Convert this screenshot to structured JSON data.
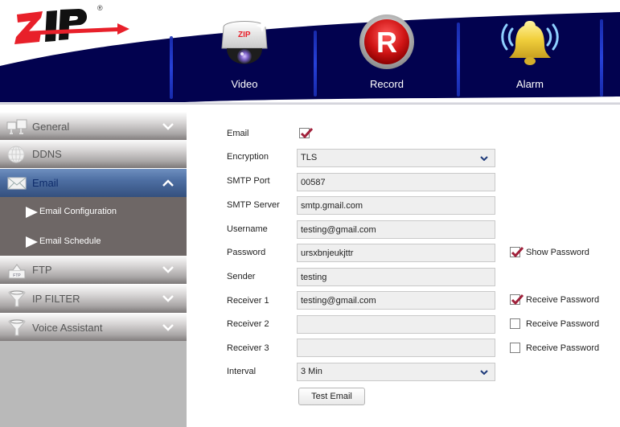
{
  "header": {
    "logo": "ZIP",
    "logo_mark": "®",
    "nav": [
      {
        "label": "Video",
        "icon": "dome-camera-icon"
      },
      {
        "label": "Record",
        "icon": "record-icon"
      },
      {
        "label": "Alarm",
        "icon": "alarm-bell-icon"
      }
    ],
    "colors": {
      "band": "#02024f",
      "logo_red": "#e8202a",
      "active_menu": "#4e6fa3",
      "check": "#a0203a"
    }
  },
  "sidebar": {
    "items": [
      {
        "label": "General",
        "icon": "network-icon",
        "expanded": false
      },
      {
        "label": "DDNS",
        "icon": "globe-icon",
        "expanded": false
      },
      {
        "label": "Email",
        "icon": "envelope-icon",
        "expanded": true
      },
      {
        "label": "FTP",
        "icon": "ftp-folder-icon",
        "expanded": false
      },
      {
        "label": "IP FILTER",
        "icon": "filter-icon",
        "expanded": false
      },
      {
        "label": "Voice Assistant",
        "icon": "filter-icon",
        "expanded": false
      }
    ],
    "email_submenu": [
      {
        "label": "Email Configuration"
      },
      {
        "label": "Email Schedule"
      }
    ]
  },
  "form": {
    "email": {
      "label": "Email",
      "checked": true
    },
    "encryption": {
      "label": "Encryption",
      "value": "TLS"
    },
    "smtp_port": {
      "label": "SMTP Port",
      "value": "00587"
    },
    "smtp_server": {
      "label": "SMTP Server",
      "value": "smtp.gmail.com"
    },
    "username": {
      "label": "Username",
      "value": "testing@gmail.com"
    },
    "password": {
      "label": "Password",
      "value": "ursxbnjeukjttr"
    },
    "show_password": {
      "label": "Show Password",
      "checked": true
    },
    "sender": {
      "label": "Sender",
      "value": "testing"
    },
    "receiver1": {
      "label": "Receiver 1",
      "value": "testing@gmail.com",
      "receive_label": "Receive Password",
      "receive_checked": true
    },
    "receiver2": {
      "label": "Receiver 2",
      "value": "",
      "receive_label": "Receive Password",
      "receive_checked": false
    },
    "receiver3": {
      "label": "Receiver 3",
      "value": "",
      "receive_label": "Receive Password",
      "receive_checked": false
    },
    "interval": {
      "label": "Interval",
      "value": "3 Min"
    },
    "test_button": "Test Email"
  }
}
